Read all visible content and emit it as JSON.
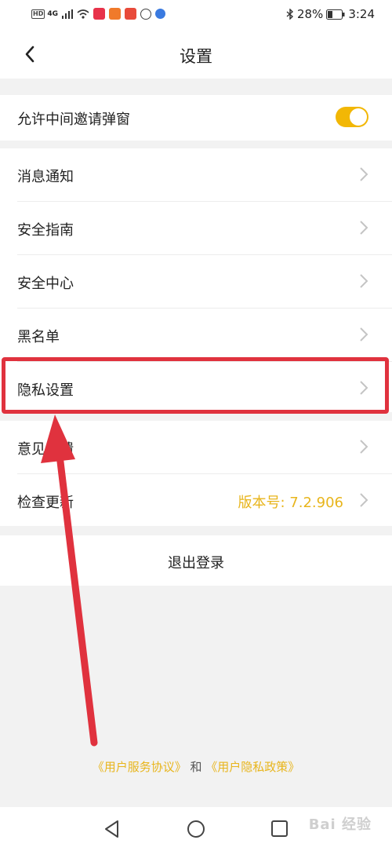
{
  "status_bar": {
    "network_badge": "HD",
    "network_type": "4G",
    "battery_percent": "28%",
    "time": "3:24"
  },
  "header": {
    "title": "设置"
  },
  "popup_section": {
    "label": "允许中间邀请弹窗",
    "toggle_on": true
  },
  "menu": {
    "items": [
      {
        "label": "消息通知"
      },
      {
        "label": "安全指南"
      },
      {
        "label": "安全中心"
      },
      {
        "label": "黑名单"
      },
      {
        "label": "隐私设置"
      }
    ]
  },
  "more": {
    "feedback_label": "意见反馈",
    "update_label": "检查更新",
    "version_text": "版本号: 7.2.906"
  },
  "logout": {
    "label": "退出登录"
  },
  "footer": {
    "service_agreement": "《用户服务协议》",
    "and_text": "和",
    "privacy_policy": "《用户隐私政策》"
  },
  "watermark": "Bai 经验",
  "colors": {
    "accent": "#f2b705",
    "link": "#e8b51c",
    "annotation": "#e0323e"
  }
}
